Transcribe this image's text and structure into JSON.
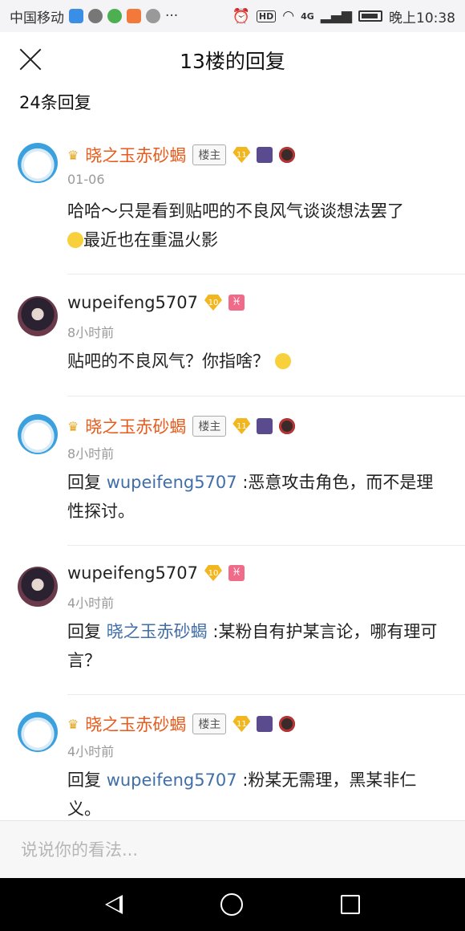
{
  "status": {
    "carrier": "中国移动",
    "dots": "···",
    "signal": "4G",
    "hd": "HD",
    "time": "晚上10:38"
  },
  "header": {
    "title": "13楼的回复"
  },
  "reply_count": "24条回复",
  "replies": [
    {
      "user": "晓之玉赤砂蝎",
      "owner_tag": "楼主",
      "level": "11",
      "time": "01-06",
      "mention": "",
      "text_line1": "哈哈～只是看到贴吧的不良风气谈谈想法罢了",
      "text_line2": "最近也在重温火影"
    },
    {
      "user": "wupeifeng5707",
      "level": "10",
      "time": "8小时前",
      "text": "贴吧的不良风气？你指啥？"
    },
    {
      "user": "晓之玉赤砂蝎",
      "owner_tag": "楼主",
      "level": "11",
      "time": "8小时前",
      "reply_prefix": "回复",
      "mention": "wupeifeng5707",
      "text": " :恶意攻击角色，而不是理性探讨。"
    },
    {
      "user": "wupeifeng5707",
      "level": "10",
      "time": "4小时前",
      "reply_prefix": "回复",
      "mention": "晓之玉赤砂蝎",
      "text": " :某粉自有护某言论，哪有理可言？"
    },
    {
      "user": "晓之玉赤砂蝎",
      "owner_tag": "楼主",
      "level": "11",
      "time": "4小时前",
      "reply_prefix": "回复",
      "mention": "wupeifeng5707",
      "text": " :粉某无需理，黑某非仁义。"
    }
  ],
  "input": {
    "placeholder": "说说你的看法..."
  },
  "colors": {
    "username_owner": "#e85a1b",
    "mention": "#3f6ea8",
    "time": "#9a9a9a",
    "level_badge": "#f2b61f"
  },
  "icons": {
    "close": "close-icon",
    "back": "back-triangle-icon",
    "home": "home-circle-icon",
    "recent": "recent-square-icon"
  }
}
